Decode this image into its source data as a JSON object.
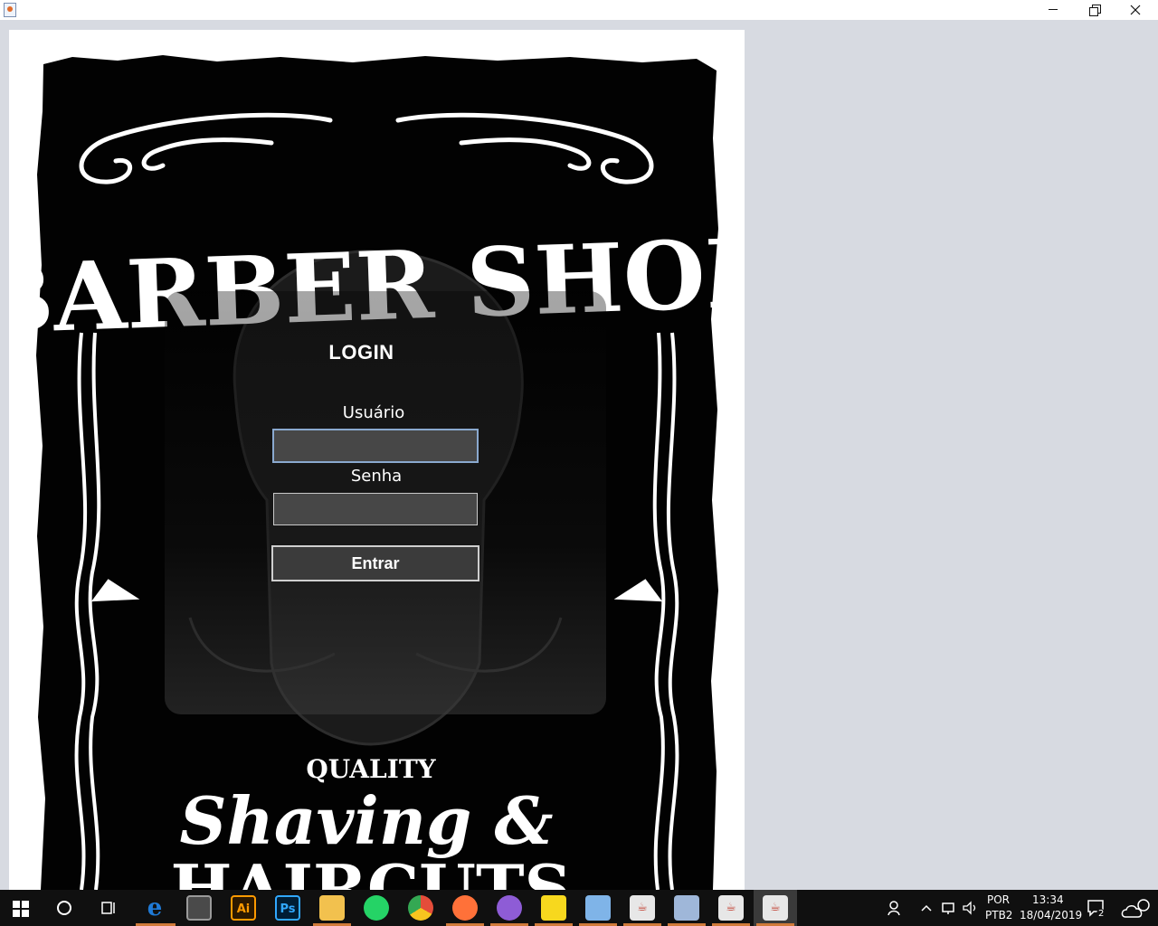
{
  "window": {
    "icon": "java-cup-icon",
    "controls": [
      "minimize-icon",
      "restore-icon",
      "close-icon"
    ]
  },
  "poster": {
    "title": "BARBER SHOP",
    "tagline_top": "QUALITY",
    "tagline_mid": "Shaving &",
    "tagline_bottom": "HAIRCUTS"
  },
  "login": {
    "title": "LOGIN",
    "user_label": "Usuário",
    "user_value": "",
    "pass_label": "Senha",
    "pass_value": "",
    "submit_label": "Entrar"
  },
  "taskbar": {
    "apps": [
      {
        "name": "start-icon"
      },
      {
        "name": "cortana-icon"
      },
      {
        "name": "task-view-icon"
      },
      {
        "name": "edge-icon",
        "glyph": "e",
        "color": "#1f7ad6"
      },
      {
        "name": "calculator-icon",
        "color": "#5b5b5b"
      },
      {
        "name": "illustrator-icon",
        "glyph": "Ai",
        "color": "#ff9a00"
      },
      {
        "name": "photoshop-icon",
        "glyph": "Ps",
        "color": "#31a8ff"
      },
      {
        "name": "file-explorer-icon",
        "color": "#f2c14e"
      },
      {
        "name": "whatsapp-icon",
        "color": "#25d366"
      },
      {
        "name": "chrome-icon",
        "color": "#e44d3a"
      },
      {
        "name": "firefox-icon",
        "color": "#ff7139"
      },
      {
        "name": "app-purple-icon",
        "color": "#8e5cd6"
      },
      {
        "name": "sticky-notes-icon",
        "color": "#f7d81e"
      },
      {
        "name": "virtualbox-icon",
        "color": "#7fb4e8"
      },
      {
        "name": "java-icon-1",
        "color": "#e7e7e7"
      },
      {
        "name": "paint-icon",
        "color": "#9fb7d9"
      },
      {
        "name": "java-icon-2",
        "color": "#e7e7e7"
      },
      {
        "name": "java-icon-3",
        "color": "#e7e7e7"
      }
    ],
    "language_top": "POR",
    "language_bottom": "PTB2",
    "time": "13:34",
    "date": "18/04/2019",
    "notification_count": "2"
  }
}
